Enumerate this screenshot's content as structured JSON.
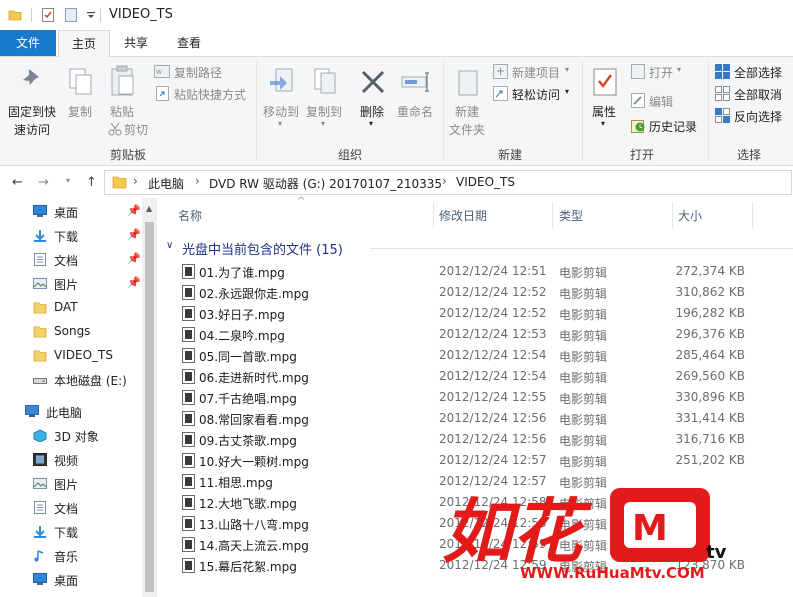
{
  "window": {
    "title": "VIDEO_TS"
  },
  "ribbon_tabs": [
    "文件",
    "主页",
    "共享",
    "查看"
  ],
  "ribbon": {
    "clipboard": {
      "pin_label_1": "固定到快",
      "pin_label_2": "速访问",
      "copy": "复制",
      "paste": "粘贴",
      "copy_path": "复制路径",
      "paste_shortcut": "粘贴快捷方式",
      "cut": "剪切",
      "group": "剪贴板"
    },
    "organize": {
      "move_to": "移动到",
      "copy_to": "复制到",
      "delete": "删除",
      "rename": "重命名",
      "group": "组织"
    },
    "new": {
      "new_folder_1": "新建",
      "new_folder_2": "文件夹",
      "new_item": "新建项目",
      "easy_access": "轻松访问",
      "group": "新建"
    },
    "open": {
      "properties": "属性",
      "open": "打开",
      "edit": "编辑",
      "history": "历史记录",
      "group": "打开"
    },
    "select": {
      "select_all": "全部选择",
      "select_none": "全部取消",
      "invert": "反向选择",
      "group": "选择"
    }
  },
  "address": {
    "crumbs": [
      "此电脑",
      "DVD RW 驱动器 (G:) 20170107_210335",
      "VIDEO_TS"
    ]
  },
  "nav": {
    "quick": [
      {
        "label": "桌面",
        "icon": "desktop-icon",
        "pinned": true
      },
      {
        "label": "下载",
        "icon": "download-icon",
        "pinned": true
      },
      {
        "label": "文档",
        "icon": "document-icon",
        "pinned": true
      },
      {
        "label": "图片",
        "icon": "picture-icon",
        "pinned": true
      },
      {
        "label": "DAT",
        "icon": "folder-icon",
        "pinned": false
      },
      {
        "label": "Songs",
        "icon": "folder-icon",
        "pinned": false
      },
      {
        "label": "VIDEO_TS",
        "icon": "folder-icon",
        "pinned": false
      },
      {
        "label": "本地磁盘 (E:)",
        "icon": "drive-icon",
        "pinned": false
      }
    ],
    "pc_label": "此电脑",
    "pc_items": [
      {
        "label": "3D 对象",
        "icon": "3d-objects-icon"
      },
      {
        "label": "视频",
        "icon": "video-icon"
      },
      {
        "label": "图片",
        "icon": "picture-icon"
      },
      {
        "label": "文档",
        "icon": "document-icon"
      },
      {
        "label": "下载",
        "icon": "download-icon"
      },
      {
        "label": "音乐",
        "icon": "music-icon"
      },
      {
        "label": "桌面",
        "icon": "desktop-icon"
      }
    ]
  },
  "columns": {
    "name": "名称",
    "modified": "修改日期",
    "type": "类型",
    "size": "大小"
  },
  "group_header": "光盘中当前包含的文件 (15)",
  "files": [
    {
      "name": "01.为了谁.mpg",
      "date": "2012/12/24 12:51",
      "type": "电影剪辑",
      "size": "272,374 KB"
    },
    {
      "name": "02.永远跟你走.mpg",
      "date": "2012/12/24 12:52",
      "type": "电影剪辑",
      "size": "310,862 KB"
    },
    {
      "name": "03.好日子.mpg",
      "date": "2012/12/24 12:52",
      "type": "电影剪辑",
      "size": "196,282 KB"
    },
    {
      "name": "04.二泉吟.mpg",
      "date": "2012/12/24 12:53",
      "type": "电影剪辑",
      "size": "296,376 KB"
    },
    {
      "name": "05.同一首歌.mpg",
      "date": "2012/12/24 12:54",
      "type": "电影剪辑",
      "size": "285,464 KB"
    },
    {
      "name": "06.走进新时代.mpg",
      "date": "2012/12/24 12:54",
      "type": "电影剪辑",
      "size": "269,560 KB"
    },
    {
      "name": "07.千古绝唱.mpg",
      "date": "2012/12/24 12:55",
      "type": "电影剪辑",
      "size": "330,896 KB"
    },
    {
      "name": "08.常回家看看.mpg",
      "date": "2012/12/24 12:56",
      "type": "电影剪辑",
      "size": "331,414 KB"
    },
    {
      "name": "09.古丈茶歌.mpg",
      "date": "2012/12/24 12:56",
      "type": "电影剪辑",
      "size": "316,716 KB"
    },
    {
      "name": "10.好大一颗树.mpg",
      "date": "2012/12/24 12:57",
      "type": "电影剪辑",
      "size": "251,202 KB"
    },
    {
      "name": "11.相思.mpg",
      "date": "2012/12/24 12:57",
      "type": "电影剪辑",
      "size": ""
    },
    {
      "name": "12.大地飞歌.mpg",
      "date": "2012/12/24 12:58",
      "type": "电影剪辑",
      "size": ""
    },
    {
      "name": "13.山路十八弯.mpg",
      "date": "2012/12/24 12:58",
      "type": "电影剪辑",
      "size": ""
    },
    {
      "name": "14.高天上流云.mpg",
      "date": "2012/12/24 12:59",
      "type": "电影剪辑",
      "size": ""
    },
    {
      "name": "15.幕后花絮.mpg",
      "date": "2012/12/24 12:59",
      "type": "电影剪辑",
      "size": "123,870 KB"
    }
  ],
  "watermark": {
    "logo_text": "如花",
    "url": "WWW.RuHuaMtv.COM"
  }
}
